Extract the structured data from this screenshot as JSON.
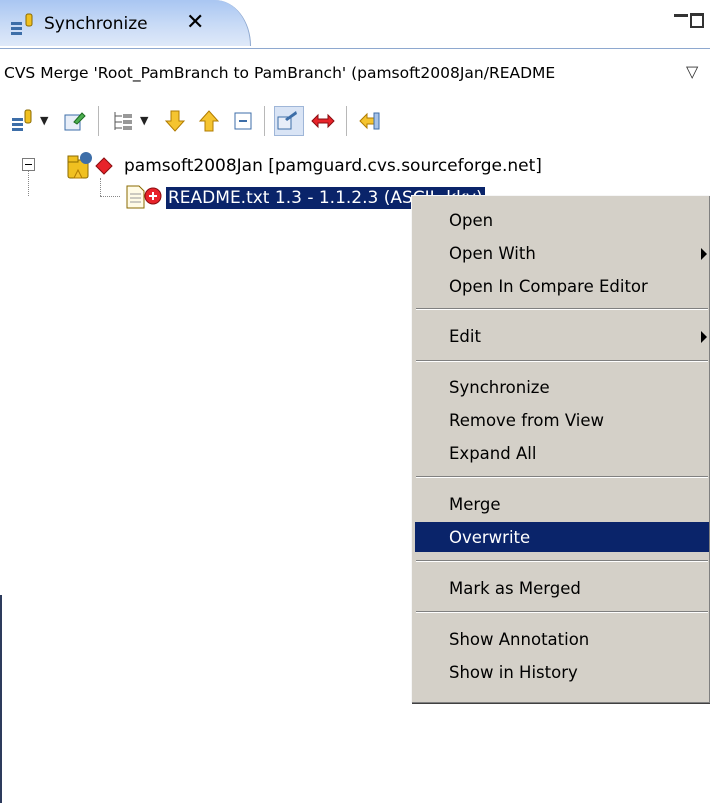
{
  "tab": {
    "title": "Synchronize",
    "close_glyph": "✕",
    "icon": "synchronize-view-icon"
  },
  "window_buttons": {
    "minimize": "minimize-icon",
    "maximize": "maximize-icon"
  },
  "description": {
    "text": "CVS Merge 'Root_PamBranch to PamBranch' (pamsoft2008Jan/README",
    "chevron": "▽"
  },
  "toolbar": {
    "items": [
      "synchronize-icon",
      "dropdown-arrow-icon",
      "commit-icon",
      "layout-icon",
      "dropdown-arrow-icon",
      "next-change-icon",
      "previous-change-icon",
      "collapse-all-icon",
      "incoming-mode-icon",
      "conflicts-mode-icon",
      "pin-icon"
    ]
  },
  "tree": {
    "project": {
      "label": "pamsoft2008Jan   [pamguard.cvs.sourceforge.net]",
      "icon": "cvs-project-conflict-icon"
    },
    "file": {
      "label": "README.txt  1.3 - 1.1.2.3  (ASCII -kkv)",
      "icon": "file-conflict-icon"
    }
  },
  "context_menu": {
    "items": [
      {
        "label": "Open",
        "submenu": false
      },
      {
        "label": "Open With",
        "submenu": true
      },
      {
        "label": "Open In Compare Editor",
        "submenu": false
      },
      {
        "label": "Edit",
        "submenu": true
      },
      {
        "label": "Synchronize",
        "submenu": false
      },
      {
        "label": "Remove from View",
        "submenu": false
      },
      {
        "label": "Expand All",
        "submenu": false
      },
      {
        "label": "Merge",
        "submenu": false
      },
      {
        "label": "Overwrite",
        "submenu": false,
        "selected": true
      },
      {
        "label": "Mark as Merged",
        "submenu": false
      },
      {
        "label": "Show Annotation",
        "submenu": false
      },
      {
        "label": "Show in History",
        "submenu": false
      }
    ]
  },
  "colors": {
    "selection": "#0a246a",
    "menu_bg": "#d4d0c8",
    "tab_bg": "#c9dbf6"
  }
}
